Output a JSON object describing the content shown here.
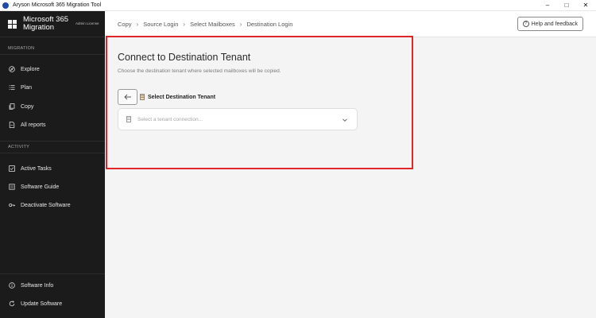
{
  "window": {
    "title": "Aryson Microsoft 365 Migration Tool",
    "controls": [
      "–",
      "□",
      "✕"
    ]
  },
  "sidebar": {
    "brand": {
      "name": "Microsoft 365 Migration",
      "license": "Admin License"
    },
    "sections": [
      {
        "label": "MIGRATION",
        "items": [
          {
            "label": "Explore",
            "icon": "compass-icon"
          },
          {
            "label": "Plan",
            "icon": "list-icon"
          },
          {
            "label": "Copy",
            "icon": "copy-icon"
          },
          {
            "label": "All reports",
            "icon": "report-icon"
          }
        ]
      },
      {
        "label": "ACTIVITY",
        "items": [
          {
            "label": "Active Tasks",
            "icon": "tasks-icon"
          },
          {
            "label": "Software Guide",
            "icon": "guide-icon"
          },
          {
            "label": "Deactivate Software",
            "icon": "key-icon"
          }
        ]
      }
    ],
    "footer": [
      {
        "label": "Software Info",
        "icon": "info-icon"
      },
      {
        "label": "Update Software",
        "icon": "update-icon"
      }
    ]
  },
  "breadcrumb": [
    "Copy",
    "Source Login",
    "Select Mailboxes",
    "Destination Login"
  ],
  "help_button": {
    "label": "Help and feedback",
    "icon": "question-icon"
  },
  "content": {
    "title": "Connect to Destination Tenant",
    "subtitle": "Choose the destination tenant where selected mailboxes will be copied.",
    "tenant_label": "Select Destination Tenant",
    "select_placeholder": "Select a tenant connection..."
  },
  "colors": {
    "sidebar_bg": "#1b1b1b",
    "main_bg": "#f4f4f4",
    "highlight_border": "#e0252b"
  }
}
